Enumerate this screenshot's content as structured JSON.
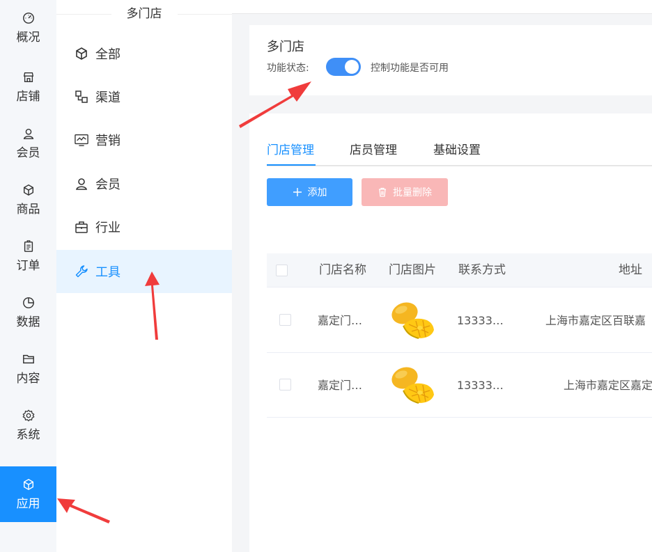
{
  "nav1": {
    "items": [
      {
        "label": "概况",
        "icon": "dashboard-icon"
      },
      {
        "label": "店铺",
        "icon": "store-icon"
      },
      {
        "label": "会员",
        "icon": "user-icon"
      },
      {
        "label": "商品",
        "icon": "box-icon"
      },
      {
        "label": "订单",
        "icon": "clipboard-icon"
      },
      {
        "label": "数据",
        "icon": "pie-chart-icon"
      },
      {
        "label": "内容",
        "icon": "folder-icon"
      },
      {
        "label": "系统",
        "icon": "gear-icon"
      },
      {
        "label": "应用",
        "icon": "cube-icon",
        "active": true
      }
    ]
  },
  "nav2": {
    "title": "多门店",
    "items": [
      {
        "label": "全部",
        "icon": "cube-icon"
      },
      {
        "label": "渠道",
        "icon": "channel-icon"
      },
      {
        "label": "营销",
        "icon": "monitor-chart-icon"
      },
      {
        "label": "会员",
        "icon": "user-icon"
      },
      {
        "label": "行业",
        "icon": "briefcase-icon"
      },
      {
        "label": "工具",
        "icon": "wrench-icon",
        "active": true
      }
    ]
  },
  "feature": {
    "title": "多门店",
    "status_label": "功能状态:",
    "status_on": true,
    "status_desc": "控制功能是否可用"
  },
  "tabs": [
    {
      "label": "门店管理",
      "active": true
    },
    {
      "label": "店员管理"
    },
    {
      "label": "基础设置"
    }
  ],
  "buttons": {
    "add_label": "添加",
    "delete_label": "批量删除"
  },
  "table": {
    "headers": [
      "门店名称",
      "门店图片",
      "联系方式",
      "地址"
    ],
    "rows": [
      {
        "name": "嘉定门…",
        "image": "mango-image",
        "phone": "13333…",
        "address": "上海市嘉定区百联嘉"
      },
      {
        "name": "嘉定门…",
        "image": "mango-image",
        "phone": "13333…",
        "address": "上海市嘉定区嘉定"
      }
    ]
  },
  "colors": {
    "accent": "#1890ff",
    "switch_on": "#3f8ff7",
    "add_button": "#409eff",
    "delete_button_disabled": "#f9b7b7",
    "annotation_arrow": "#f03c3c"
  }
}
